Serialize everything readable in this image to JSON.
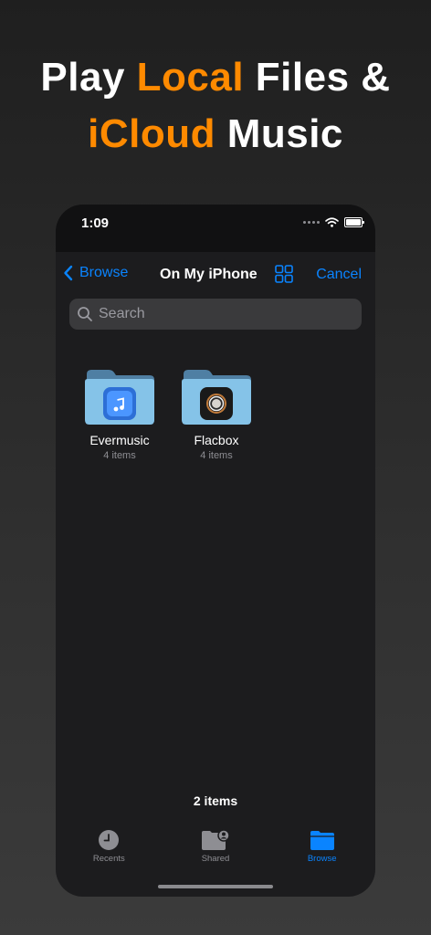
{
  "headline": {
    "line1_pre": "Play ",
    "line1_accent": "Local",
    "line1_post": " Files &",
    "line2_accent": "iCloud",
    "line2_post": " Music"
  },
  "colors": {
    "accent": "#ff8a00",
    "link": "#0a84ff",
    "background": "#1c1c1e"
  },
  "status_bar": {
    "time": "1:09"
  },
  "nav": {
    "back_label": "Browse",
    "title": "On My iPhone",
    "cancel_label": "Cancel"
  },
  "search": {
    "placeholder": "Search"
  },
  "folders": [
    {
      "name": "Evermusic",
      "count": "4 items",
      "icon": "music-app-icon"
    },
    {
      "name": "Flacbox",
      "count": "4 items",
      "icon": "flacbox-app-icon"
    }
  ],
  "footer": {
    "item_total": "2 items"
  },
  "tabs": [
    {
      "label": "Recents",
      "icon": "clock-icon"
    },
    {
      "label": "Shared",
      "icon": "shared-folder-icon"
    },
    {
      "label": "Browse",
      "icon": "folder-icon",
      "active": true
    }
  ]
}
